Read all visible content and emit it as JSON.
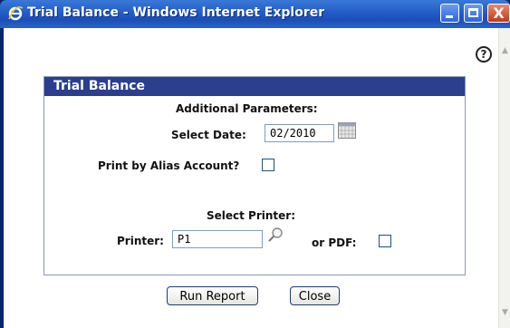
{
  "window": {
    "title": "Trial Balance - Windows Internet Explorer"
  },
  "panel": {
    "header": "Trial Balance",
    "additional_parameters_label": "Additional Parameters:",
    "select_date_label": "Select Date:",
    "date_value": "02/2010",
    "print_by_alias_label": "Print by Alias Account?",
    "select_printer_label": "Select Printer:",
    "printer_label": "Printer:",
    "printer_value": "P1",
    "or_pdf_label": "or PDF:"
  },
  "buttons": {
    "run_report": "Run Report",
    "close": "Close"
  },
  "help": {
    "glyph": "?"
  },
  "titlebar_buttons": {
    "close_glyph": "X"
  },
  "colors": {
    "panel_header": "#2b3f8e",
    "titlebar": "#2560c8"
  }
}
